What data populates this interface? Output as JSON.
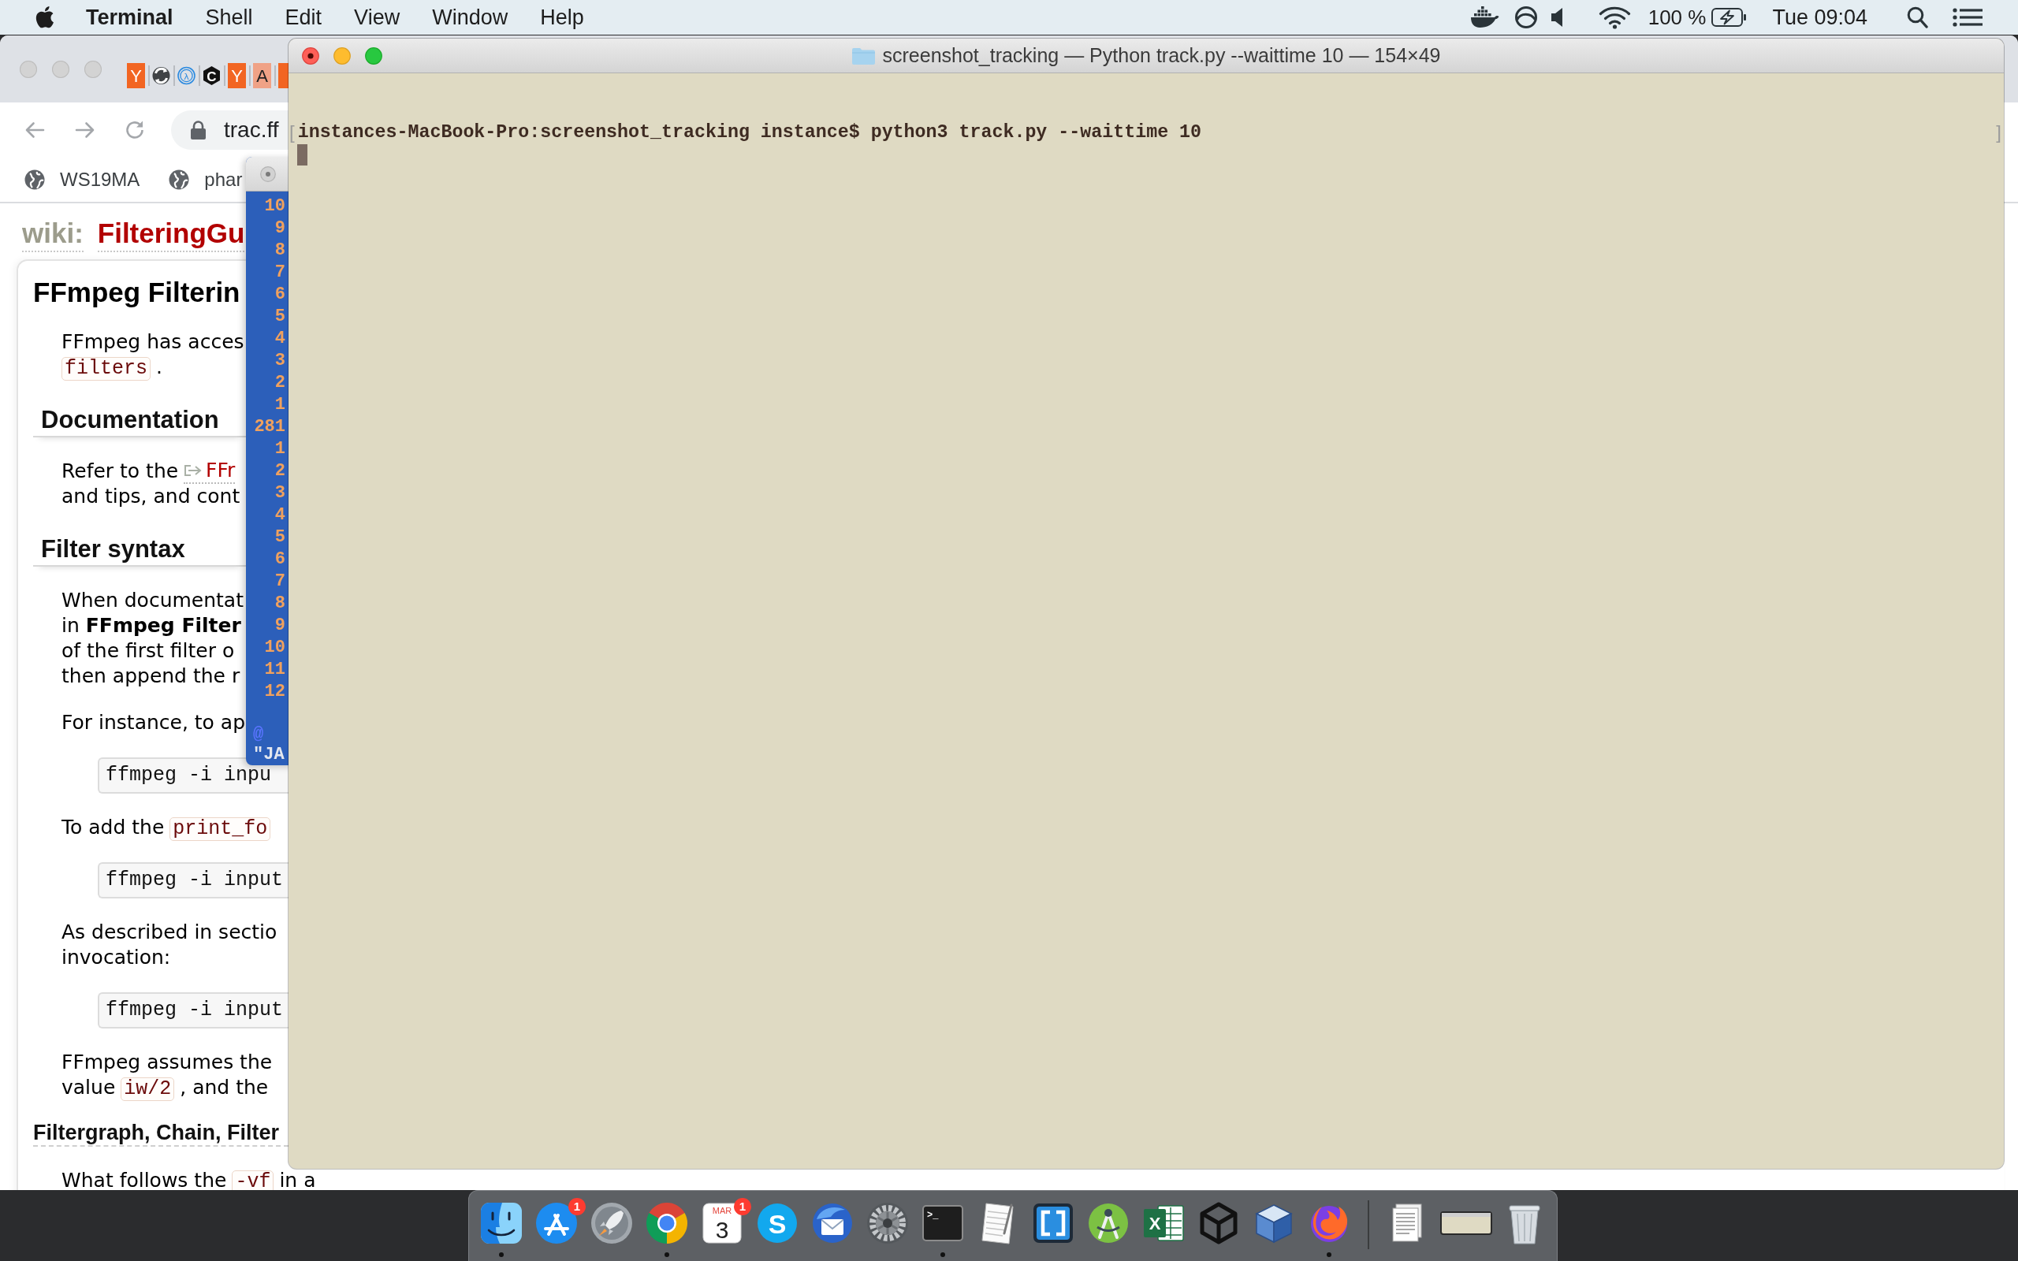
{
  "menu_bar": {
    "app_name": "Terminal",
    "menus": [
      "Shell",
      "Edit",
      "View",
      "Window",
      "Help"
    ],
    "battery_percent": "100 %",
    "clock": "Tue 09:04"
  },
  "browser": {
    "tabs": [
      {
        "kind": "letter-tile",
        "letter": "Y",
        "color": "#f26522"
      },
      {
        "kind": "swirl"
      },
      {
        "kind": "ring",
        "letter": "λ"
      },
      {
        "kind": "hexagon",
        "letter": "C"
      },
      {
        "kind": "letter-tile",
        "letter": "Y",
        "color": "#f26522"
      },
      {
        "kind": "letter-tile",
        "letter": "A",
        "color": "#f0a286"
      },
      {
        "kind": "tile",
        "color": "#f26522"
      }
    ],
    "url": "trac.ff",
    "bookmarks": [
      "WS19MA",
      "phar"
    ],
    "page": {
      "namespace": "wiki:",
      "page_name": "FilteringGu",
      "title": "FFmpeg Filterin",
      "blocks": [
        {
          "kind": "paragraph",
          "lines": [
            [
              {
                "kind": "text",
                "text": "FFmpeg has acces"
              }
            ],
            [
              {
                "kind": "code",
                "text": "filters"
              },
              {
                "kind": "text",
                "text": "."
              }
            ]
          ]
        },
        {
          "kind": "heading",
          "text": "Documentation"
        },
        {
          "kind": "paragraph",
          "lines": [
            [
              {
                "kind": "text",
                "text": "Refer to the"
              },
              {
                "kind": "external-link",
                "text": "FFr"
              }
            ],
            [
              {
                "kind": "text",
                "text": "and tips, and cont"
              }
            ]
          ]
        },
        {
          "kind": "heading",
          "text": "Filter syntax"
        },
        {
          "kind": "paragraph",
          "lines": [
            [
              {
                "kind": "text",
                "text": "When documentat"
              }
            ],
            [
              {
                "kind": "text",
                "text": "in **FFmpeg Filter**"
              }
            ],
            [
              {
                "kind": "text",
                "text": "of the first filter o"
              }
            ],
            [
              {
                "kind": "text",
                "text": "then append the r"
              }
            ]
          ]
        },
        {
          "kind": "paragraph",
          "lines": [
            [
              {
                "kind": "text",
                "text": "For instance, to ap"
              }
            ]
          ]
        },
        {
          "kind": "code-block",
          "text": "ffmpeg -i inpu"
        },
        {
          "kind": "paragraph",
          "lines": [
            [
              {
                "kind": "text",
                "text": "To add the"
              },
              {
                "kind": "code",
                "text": "print_fo"
              }
            ]
          ]
        },
        {
          "kind": "code-block",
          "text": "ffmpeg -i input"
        },
        {
          "kind": "paragraph",
          "lines": [
            [
              {
                "kind": "text",
                "text": "As described in sectio"
              }
            ],
            [
              {
                "kind": "text",
                "text": "invocation:"
              }
            ]
          ]
        },
        {
          "kind": "code-block",
          "text": "ffmpeg -i input"
        },
        {
          "kind": "paragraph",
          "lines": [
            [
              {
                "kind": "text",
                "text": "FFmpeg assumes the"
              }
            ],
            [
              {
                "kind": "text",
                "text": "value"
              },
              {
                "kind": "code",
                "text": "iw/2"
              },
              {
                "kind": "text",
                "text": ", and the"
              }
            ]
          ]
        },
        {
          "kind": "subheading",
          "text": "Filtergraph, Chain, Filter"
        },
        {
          "kind": "paragraph",
          "lines": [
            [
              {
                "kind": "text",
                "text": "What follows the"
              },
              {
                "kind": "code",
                "text": "-vf"
              },
              {
                "kind": "text",
                "text": "in a"
              }
            ]
          ]
        }
      ]
    }
  },
  "editor_window": {
    "line_numbers": [
      "10",
      "9",
      "8",
      "7",
      "6",
      "5",
      "4",
      "3",
      "2",
      "1",
      "281",
      "1",
      "2",
      "3",
      "4",
      "5",
      "6",
      "7",
      "8",
      "9",
      "10",
      "11",
      "12"
    ],
    "more_marker": "@",
    "bottom_line": "\"JA"
  },
  "terminal": {
    "title": "screenshot_tracking — Python track.py --waittime 10 — 154×49",
    "lines": [
      {
        "mark_open": "[",
        "text": "instances-MacBook-Pro:screenshot_tracking instance$ python3 track.py --waittime 10",
        "mark_close": "]"
      }
    ]
  },
  "dock": {
    "items": [
      {
        "kind": "face",
        "running": true
      },
      {
        "kind": "pencil",
        "running": false,
        "badge": "1"
      },
      {
        "kind": "rocket",
        "running": false
      },
      {
        "kind": "wheel",
        "running": true
      },
      {
        "kind": "calendar",
        "running": false,
        "badge": "1",
        "month": "MAR",
        "day": "3"
      },
      {
        "kind": "bubble",
        "running": false,
        "letter": "S"
      },
      {
        "kind": "bird",
        "running": false
      },
      {
        "kind": "gear",
        "running": false
      },
      {
        "kind": "console",
        "running": true,
        "prompt": ">_"
      },
      {
        "kind": "notepad",
        "running": false
      },
      {
        "kind": "frame",
        "running": false
      },
      {
        "kind": "compass",
        "running": false
      },
      {
        "kind": "sheet",
        "running": false,
        "letter": "X"
      },
      {
        "kind": "cube",
        "running": false
      },
      {
        "kind": "box",
        "running": false
      },
      {
        "kind": "fox",
        "running": true
      }
    ]
  }
}
